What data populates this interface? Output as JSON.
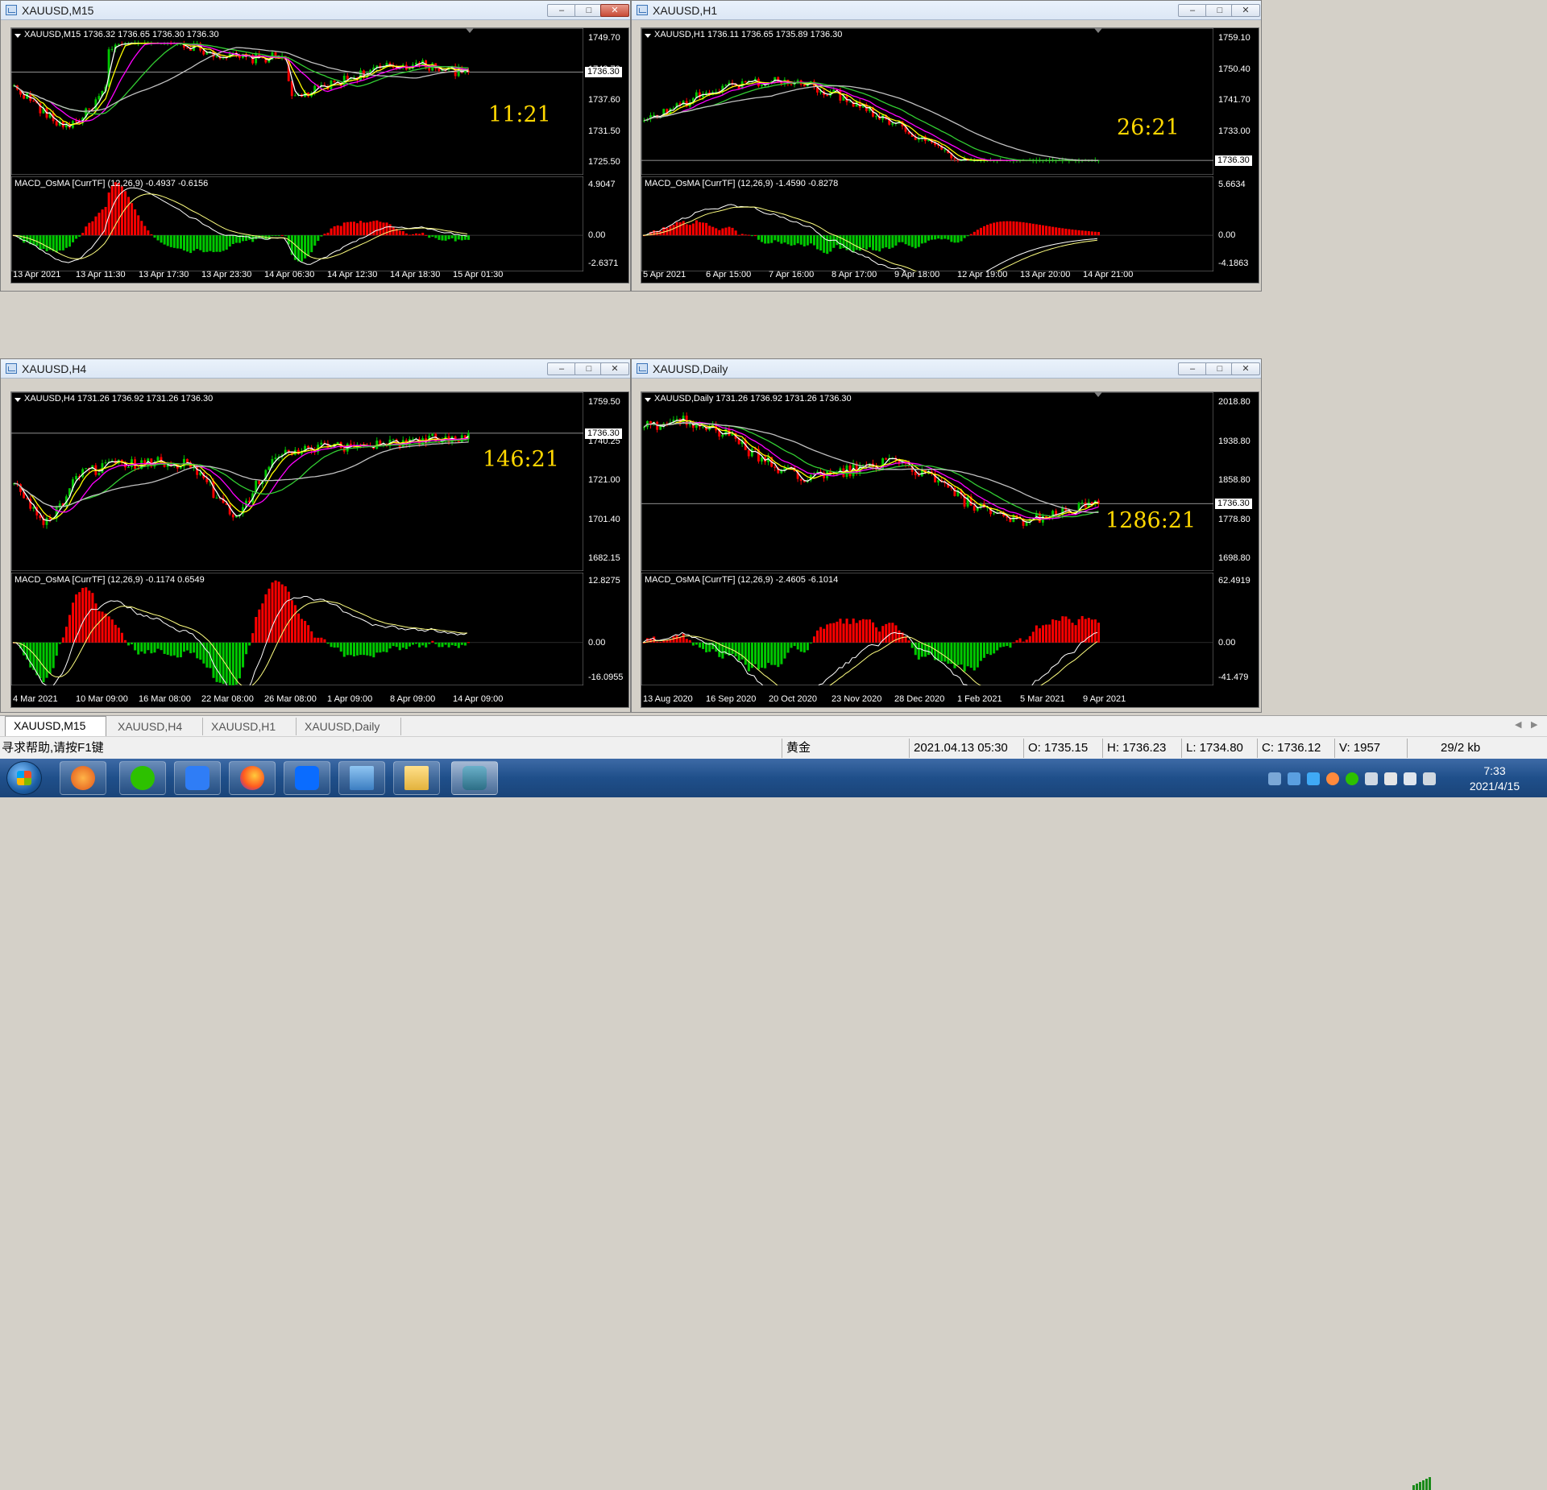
{
  "windows": [
    {
      "id": "m15",
      "title": "XAUUSD,M15",
      "active": true,
      "price_header": "XAUUSD,M15  1736.32 1736.65 1736.30 1736.30",
      "indicator_header": "MACD_OsMA [CurrTF] (12,26,9) -0.4937 -0.6156",
      "countdown": "11:21",
      "price_axis": [
        "1749.70",
        "1743.70",
        "1737.60",
        "1731.50",
        "1725.50"
      ],
      "current_price": "1736.30",
      "indicator_axis": [
        "4.9047",
        "0.00",
        "-2.6371"
      ],
      "time_axis": [
        "13 Apr 2021",
        "13 Apr 11:30",
        "13 Apr 17:30",
        "13 Apr 23:30",
        "14 Apr 06:30",
        "14 Apr 12:30",
        "14 Apr 18:30",
        "15 Apr 01:30"
      ]
    },
    {
      "id": "h1",
      "title": "XAUUSD,H1",
      "active": false,
      "price_header": "XAUUSD,H1  1736.11 1736.65 1735.89 1736.30",
      "indicator_header": "MACD_OsMA [CurrTF] (12,26,9) -1.4590 -0.8278",
      "countdown": "26:21",
      "price_axis": [
        "1759.10",
        "1750.40",
        "1741.70",
        "1733.00",
        "1724.30"
      ],
      "current_price": "1736.30",
      "indicator_axis": [
        "5.6634",
        "0.00",
        "-4.1863"
      ],
      "time_axis": [
        "5 Apr 2021",
        "6 Apr 15:00",
        "7 Apr 16:00",
        "8 Apr 17:00",
        "9 Apr 18:00",
        "12 Apr 19:00",
        "13 Apr 20:00",
        "14 Apr 21:00"
      ]
    },
    {
      "id": "h4",
      "title": "XAUUSD,H4",
      "active": false,
      "price_header": "XAUUSD,H4  1731.26 1736.92 1731.26 1736.30",
      "indicator_header": "MACD_OsMA [CurrTF] (12,26,9) -0.1174 0.6549",
      "countdown": "146:21",
      "price_axis": [
        "1759.50",
        "1740.25",
        "1721.00",
        "1701.40",
        "1682.15"
      ],
      "current_price": "1736.30",
      "indicator_axis": [
        "12.8275",
        "0.00",
        "-16.0955"
      ],
      "time_axis": [
        "4 Mar 2021",
        "10 Mar 09:00",
        "16 Mar 08:00",
        "22 Mar 08:00",
        "26 Mar 08:00",
        "1 Apr 09:00",
        "8 Apr 09:00",
        "14 Apr 09:00"
      ]
    },
    {
      "id": "d1",
      "title": "XAUUSD,Daily",
      "active": false,
      "price_header": "XAUUSD,Daily  1731.26 1736.92 1731.26 1736.30",
      "indicator_header": "MACD_OsMA [CurrTF] (12,26,9) -2.4605 -6.1014",
      "countdown": "1286:21",
      "price_axis": [
        "2018.80",
        "1938.80",
        "1858.80",
        "1778.80",
        "1698.80"
      ],
      "current_price": "1736.30",
      "indicator_axis": [
        "62.4919",
        "0.00",
        "-41.479"
      ],
      "time_axis": [
        "13 Aug 2020",
        "16 Sep 2020",
        "20 Oct 2020",
        "23 Nov 2020",
        "28 Dec 2020",
        "1 Feb 2021",
        "5 Mar 2021",
        "9 Apr 2021"
      ]
    }
  ],
  "tabs": [
    "XAUUSD,M15",
    "XAUUSD,H4",
    "XAUUSD,H1",
    "XAUUSD,Daily"
  ],
  "active_tab": 0,
  "status": {
    "help": "寻求帮助,请按F1键",
    "symbol_name": "黄金",
    "datetime": "2021.04.13 05:30",
    "open": "O: 1735.15",
    "high": "H: 1736.23",
    "low": "L: 1734.80",
    "close": "C: 1736.12",
    "volume": "V: 1957",
    "traffic": "29/2 kb"
  },
  "taskbar": {
    "time": "7:33",
    "date": "2021/4/15",
    "apps": [
      "start-orb",
      "app-orange-arrow",
      "wechat",
      "feishu-pen",
      "firefox",
      "tencent-meeting",
      "photo-viewer",
      "file-explorer",
      "metatrader"
    ]
  },
  "colors": {
    "bull": "#00c800",
    "bear": "#ff0000",
    "ma_white": "#ffffff",
    "ma_yellow": "#ffff00",
    "ma_magenta": "#ff00ff",
    "ma_green": "#32cd32",
    "ma_gray": "#c0c0c0",
    "countdown": "#ffd700"
  }
}
